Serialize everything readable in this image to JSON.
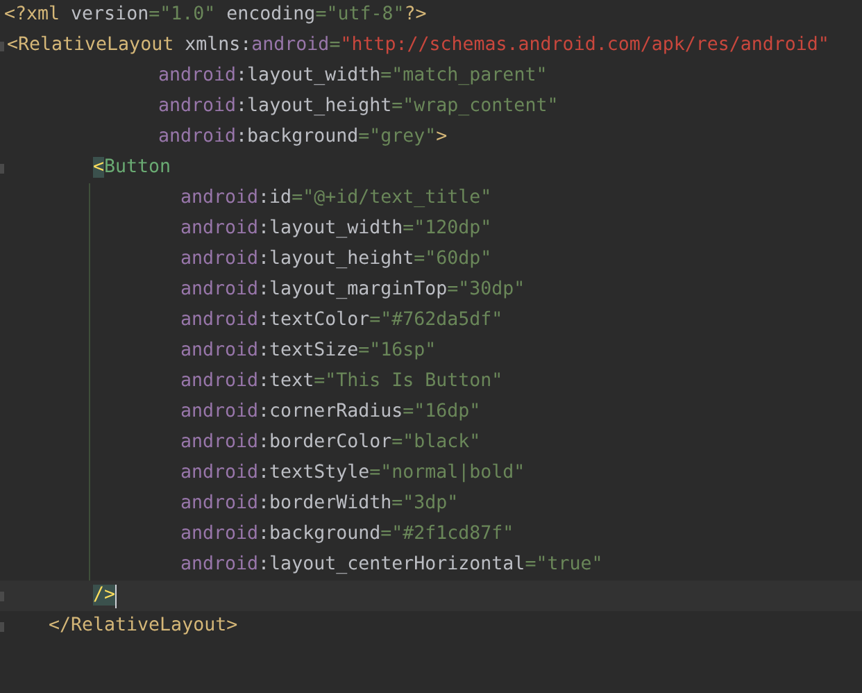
{
  "editor": {
    "lines": [
      {
        "kind": "prolog",
        "current": false,
        "fold_mark": false,
        "tokens": [
          {
            "kind": "tag",
            "text": "<?xml"
          },
          {
            "kind": "attr",
            "text": " version"
          },
          {
            "kind": "value",
            "text": "=\"1.0\""
          },
          {
            "kind": "attr",
            "text": " encoding"
          },
          {
            "kind": "value",
            "text": "=\"utf-8\""
          },
          {
            "kind": "tag",
            "text": "?>"
          }
        ]
      },
      {
        "kind": "open_tag",
        "current": false,
        "fold_mark": true,
        "tokens": [
          {
            "kind": "tag",
            "text": "<RelativeLayout"
          },
          {
            "kind": "attr",
            "text": " xmlns:"
          },
          {
            "kind": "ns",
            "text": "android"
          },
          {
            "kind": "value",
            "text": "="
          },
          {
            "kind": "url",
            "text": "\"http://schemas.android.com/apk/res/android\""
          }
        ],
        "children": [
          {
            "kind": "attribute",
            "current": false,
            "fold_mark": false,
            "tokens": [
              {
                "kind": "ns",
                "text": "android"
              },
              {
                "kind": "attr",
                "text": ":layout_width"
              },
              {
                "kind": "value",
                "text": "=\"match_parent\""
              }
            ]
          },
          {
            "kind": "attribute",
            "current": false,
            "fold_mark": false,
            "tokens": [
              {
                "kind": "ns",
                "text": "android"
              },
              {
                "kind": "attr",
                "text": ":layout_height"
              },
              {
                "kind": "value",
                "text": "=\"wrap_content\""
              }
            ]
          },
          {
            "kind": "attribute",
            "current": false,
            "fold_mark": false,
            "tokens": [
              {
                "kind": "ns",
                "text": "android"
              },
              {
                "kind": "attr",
                "text": ":background"
              },
              {
                "kind": "value",
                "text": "=\"grey\""
              },
              {
                "kind": "tag",
                "text": ">"
              }
            ]
          },
          {
            "kind": "open_tag",
            "current": false,
            "fold_mark": true,
            "tokens": [
              {
                "kind": "match",
                "text": "<"
              },
              {
                "kind": "view_tag",
                "text": "Button"
              }
            ],
            "children": [
              {
                "kind": "attribute",
                "current": false,
                "fold_mark": false,
                "tokens": [
                  {
                    "kind": "ns",
                    "text": "android"
                  },
                  {
                    "kind": "attr",
                    "text": ":id"
                  },
                  {
                    "kind": "value",
                    "text": "=\"@+id/text_title\""
                  }
                ]
              },
              {
                "kind": "attribute",
                "current": false,
                "fold_mark": false,
                "tokens": [
                  {
                    "kind": "ns",
                    "text": "android"
                  },
                  {
                    "kind": "attr",
                    "text": ":layout_width"
                  },
                  {
                    "kind": "value",
                    "text": "=\"120dp\""
                  }
                ]
              },
              {
                "kind": "attribute",
                "current": false,
                "fold_mark": false,
                "tokens": [
                  {
                    "kind": "ns",
                    "text": "android"
                  },
                  {
                    "kind": "attr",
                    "text": ":layout_height"
                  },
                  {
                    "kind": "value",
                    "text": "=\"60dp\""
                  }
                ]
              },
              {
                "kind": "attribute",
                "current": false,
                "fold_mark": false,
                "tokens": [
                  {
                    "kind": "ns",
                    "text": "android"
                  },
                  {
                    "kind": "attr",
                    "text": ":layout_marginTop"
                  },
                  {
                    "kind": "value",
                    "text": "=\"30dp\""
                  }
                ]
              },
              {
                "kind": "attribute",
                "current": false,
                "fold_mark": false,
                "tokens": [
                  {
                    "kind": "ns",
                    "text": "android"
                  },
                  {
                    "kind": "attr",
                    "text": ":textColor"
                  },
                  {
                    "kind": "value",
                    "text": "=\"#762da5df\""
                  }
                ]
              },
              {
                "kind": "attribute",
                "current": false,
                "fold_mark": false,
                "tokens": [
                  {
                    "kind": "ns",
                    "text": "android"
                  },
                  {
                    "kind": "attr",
                    "text": ":textSize"
                  },
                  {
                    "kind": "value",
                    "text": "=\"16sp\""
                  }
                ]
              },
              {
                "kind": "attribute",
                "current": false,
                "fold_mark": false,
                "tokens": [
                  {
                    "kind": "ns",
                    "text": "android"
                  },
                  {
                    "kind": "attr",
                    "text": ":text"
                  },
                  {
                    "kind": "value",
                    "text": "=\"This Is Button\""
                  }
                ]
              },
              {
                "kind": "attribute",
                "current": false,
                "fold_mark": false,
                "tokens": [
                  {
                    "kind": "ns",
                    "text": "android"
                  },
                  {
                    "kind": "attr",
                    "text": ":cornerRadius"
                  },
                  {
                    "kind": "value",
                    "text": "=\"16dp\""
                  }
                ]
              },
              {
                "kind": "attribute",
                "current": false,
                "fold_mark": false,
                "tokens": [
                  {
                    "kind": "ns",
                    "text": "android"
                  },
                  {
                    "kind": "attr",
                    "text": ":borderColor"
                  },
                  {
                    "kind": "value",
                    "text": "=\"black\""
                  }
                ]
              },
              {
                "kind": "attribute",
                "current": false,
                "fold_mark": false,
                "tokens": [
                  {
                    "kind": "ns",
                    "text": "android"
                  },
                  {
                    "kind": "attr",
                    "text": ":textStyle"
                  },
                  {
                    "kind": "value",
                    "text": "=\"normal|bold\""
                  }
                ]
              },
              {
                "kind": "attribute",
                "current": false,
                "fold_mark": false,
                "tokens": [
                  {
                    "kind": "ns",
                    "text": "android"
                  },
                  {
                    "kind": "attr",
                    "text": ":borderWidth"
                  },
                  {
                    "kind": "value",
                    "text": "=\"3dp\""
                  }
                ]
              },
              {
                "kind": "attribute",
                "current": false,
                "fold_mark": false,
                "tokens": [
                  {
                    "kind": "ns",
                    "text": "android"
                  },
                  {
                    "kind": "attr",
                    "text": ":background"
                  },
                  {
                    "kind": "value",
                    "text": "=\"#2f1cd87f\""
                  }
                ]
              },
              {
                "kind": "attribute",
                "current": false,
                "fold_mark": false,
                "tokens": [
                  {
                    "kind": "ns",
                    "text": "android"
                  },
                  {
                    "kind": "attr",
                    "text": ":layout_centerHorizontal"
                  },
                  {
                    "kind": "value",
                    "text": "=\"true\""
                  }
                ]
              },
              {
                "kind": "self_close",
                "current": true,
                "fold_mark": true,
                "tokens": [
                  {
                    "kind": "match",
                    "text": "/>"
                  }
                ]
              }
            ]
          }
        ]
      },
      {
        "kind": "close_tag",
        "current": false,
        "fold_mark": true,
        "tokens": [
          {
            "kind": "tag",
            "text": "</RelativeLayout>"
          }
        ]
      }
    ]
  }
}
